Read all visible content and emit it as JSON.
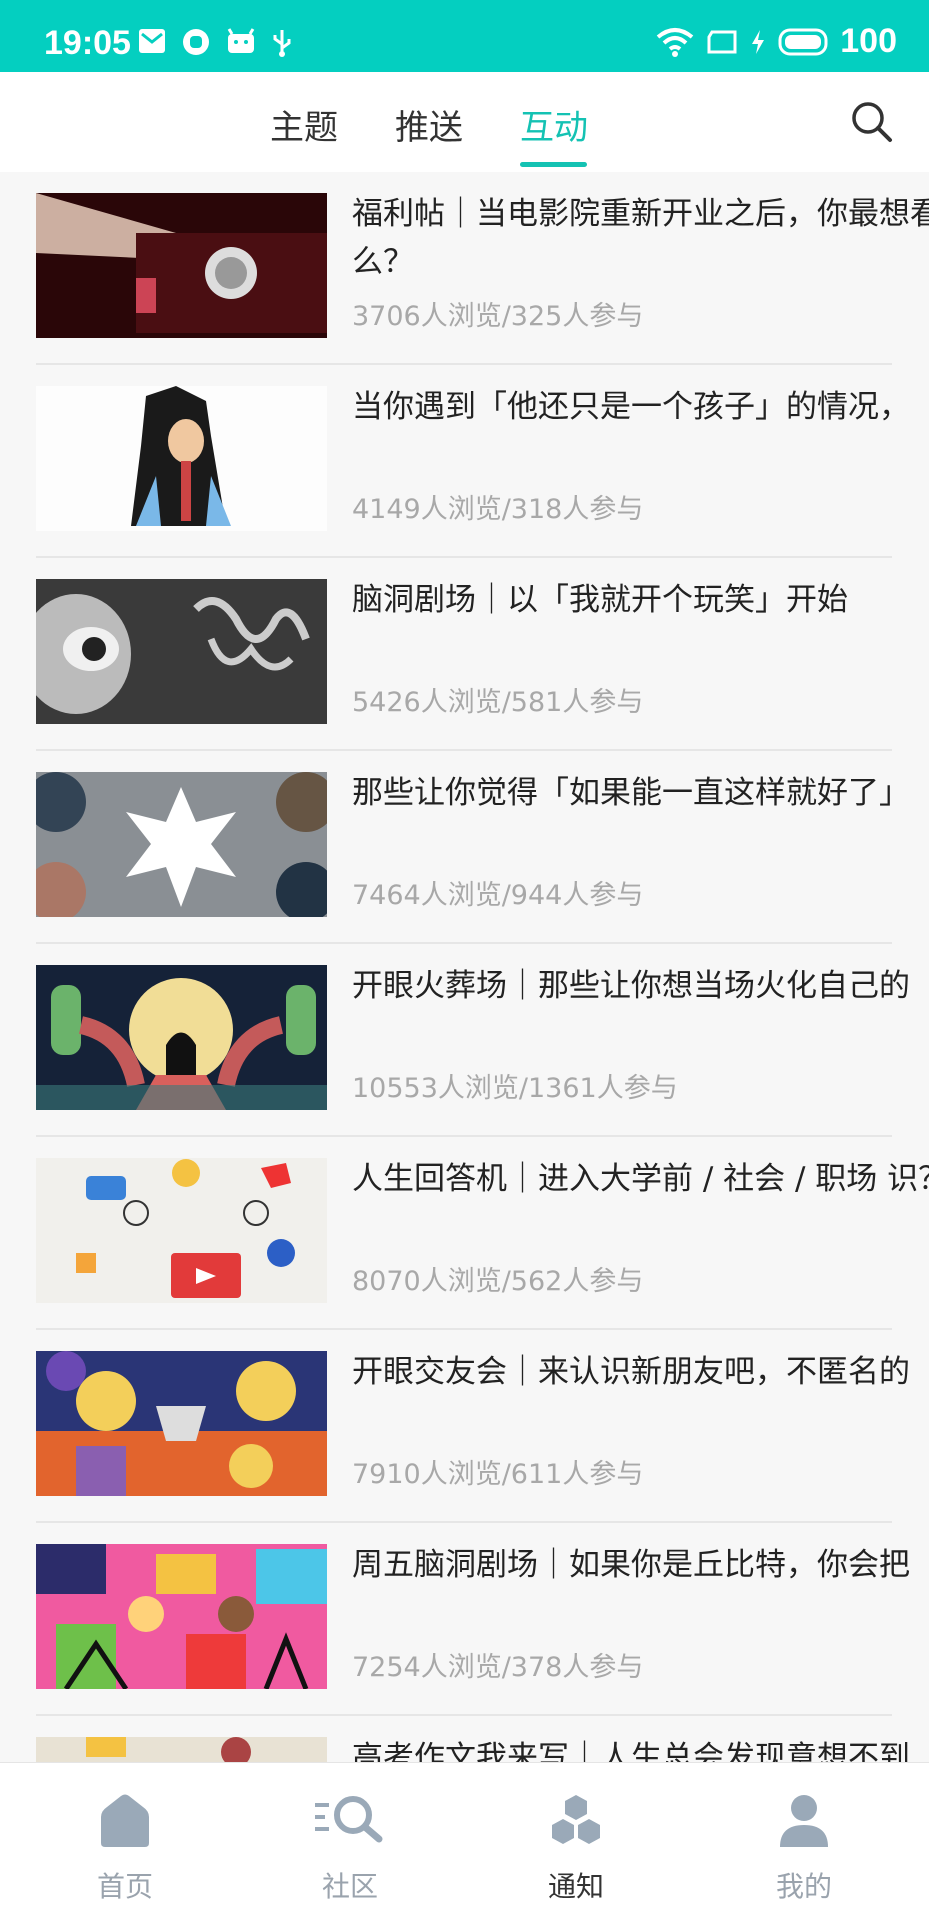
{
  "status": {
    "time": "19:05",
    "battery": "100"
  },
  "tabs": [
    {
      "label": "主题"
    },
    {
      "label": "推送"
    },
    {
      "label": "互动"
    }
  ],
  "feed": [
    {
      "title": "福利帖｜当电影院重新开业之后，你最想看什么？",
      "meta": "3706人浏览/325人参与"
    },
    {
      "title": "当你遇到「他还只是一个孩子」的情况，",
      "meta": "4149人浏览/318人参与"
    },
    {
      "title": "脑洞剧场｜以「我就开个玩笑」开始",
      "meta": "5426人浏览/581人参与"
    },
    {
      "title": "那些让你觉得「如果能一直这样就好了」",
      "meta": "7464人浏览/944人参与"
    },
    {
      "title": "开眼火葬场｜那些让你想当场火化自己的",
      "meta": "10553人浏览/1361人参与"
    },
    {
      "title": "人生回答机｜进入大学前 / 社会 / 职场 识？",
      "meta": "8070人浏览/562人参与"
    },
    {
      "title": "开眼交友会｜来认识新朋友吧，不匿名的",
      "meta": "7910人浏览/611人参与"
    },
    {
      "title": "周五脑洞剧场｜如果你是丘比特，你会把",
      "meta": "7254人浏览/378人参与"
    },
    {
      "title": "高考作文我来写｜人生总会发现意想不到",
      "meta": ""
    }
  ],
  "bottom_nav": [
    {
      "label": "首页",
      "icon": "home-icon"
    },
    {
      "label": "社区",
      "icon": "community-search-icon"
    },
    {
      "label": "通知",
      "icon": "notification-cubes-icon"
    },
    {
      "label": "我的",
      "icon": "profile-icon"
    }
  ],
  "colors": {
    "accent": "#14c2b3",
    "status_bar": "#04cfc0"
  }
}
